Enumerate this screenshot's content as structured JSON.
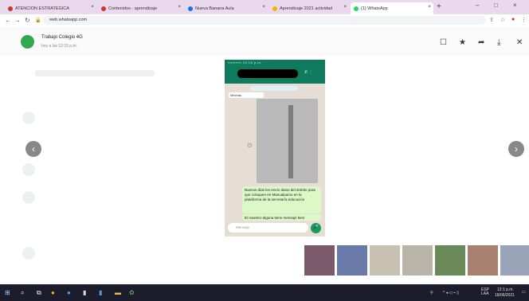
{
  "browser": {
    "tabs": [
      {
        "label": "ATENCION ESTRATEGICA",
        "fav": "#c0392b"
      },
      {
        "label": "Contenidos - aprendizaje",
        "fav": "#c0392b"
      },
      {
        "label": "Nueva Banana Aula",
        "fav": "#1a73e8"
      },
      {
        "label": "Aprendizaje 2021 actividad",
        "fav": "#f4b400"
      },
      {
        "label": "(1) WhatsApp",
        "fav": "#25d366"
      }
    ],
    "url": "web.whatsapp.com"
  },
  "viewer": {
    "chat_name": "Trabajo Colegio 4G",
    "chat_date": "hoy a las 12:15 p.m."
  },
  "phone": {
    "status_text": "▪▪▪▪▪▪▪▪▪ 12:15 p.m.",
    "msg_label": "Mechas",
    "bubble1": "Buenos días les envío datos del ámbito para que coloquen en Manualpamo en la plataforma de la secretaría educación",
    "bubble2": "El maestro alguna tiene mensaje bien",
    "input_placeholder": "Mensaje"
  },
  "taskbar": {
    "lang": "ESP LAA",
    "time": "12:1 p.m.",
    "date": "18/06/2021"
  },
  "thumbnails": [
    "#7a5a6a",
    "#6a7aa8",
    "#c8c0b0",
    "#b8b4a8",
    "#6a8a5a",
    "#a88070",
    "#9aa4b8"
  ],
  "colors": {
    "whatsapp_green": "#0f7a5c",
    "bubble_green": "#dcf8c6"
  }
}
